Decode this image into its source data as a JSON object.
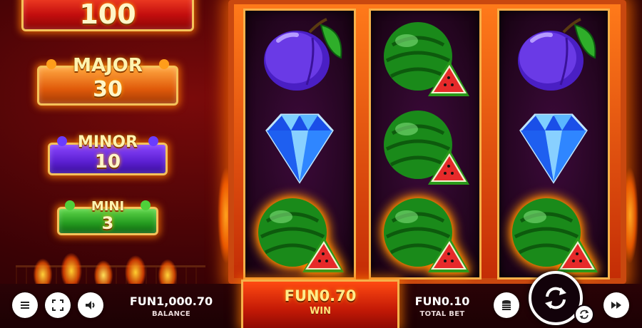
{
  "jackpots": {
    "grand": {
      "value": "100"
    },
    "major": {
      "label": "MAJOR",
      "value": "30"
    },
    "minor": {
      "label": "MINOR",
      "value": "10"
    },
    "mini": {
      "label": "MINI",
      "value": "3"
    }
  },
  "reels": [
    [
      "plum",
      "diamond",
      "watermelon-fire"
    ],
    [
      "watermelon",
      "watermelon",
      "watermelon-fire"
    ],
    [
      "plum",
      "diamond",
      "watermelon-fire"
    ]
  ],
  "bottom_bar": {
    "balance": {
      "value": "FUN1,000.70",
      "label": "BALANCE"
    },
    "win": {
      "value": "FUN0.70",
      "label": "WIN"
    },
    "total_bet": {
      "value": "FUN0.10",
      "label": "TOTAL BET"
    },
    "icons": {
      "menu": "menu-icon",
      "fullscreen": "fullscreen-icon",
      "sound": "sound-icon",
      "coins": "coins-stack-icon",
      "spin": "spin-arrows-icon",
      "autoplay": "autoplay-icon",
      "turbo": "fast-forward-icon"
    }
  },
  "colors": {
    "grand": "#c40e0e",
    "major": "#e05a0a",
    "minor": "#5b1fd1",
    "mini": "#249a1f",
    "frame": "#f5b14a"
  }
}
